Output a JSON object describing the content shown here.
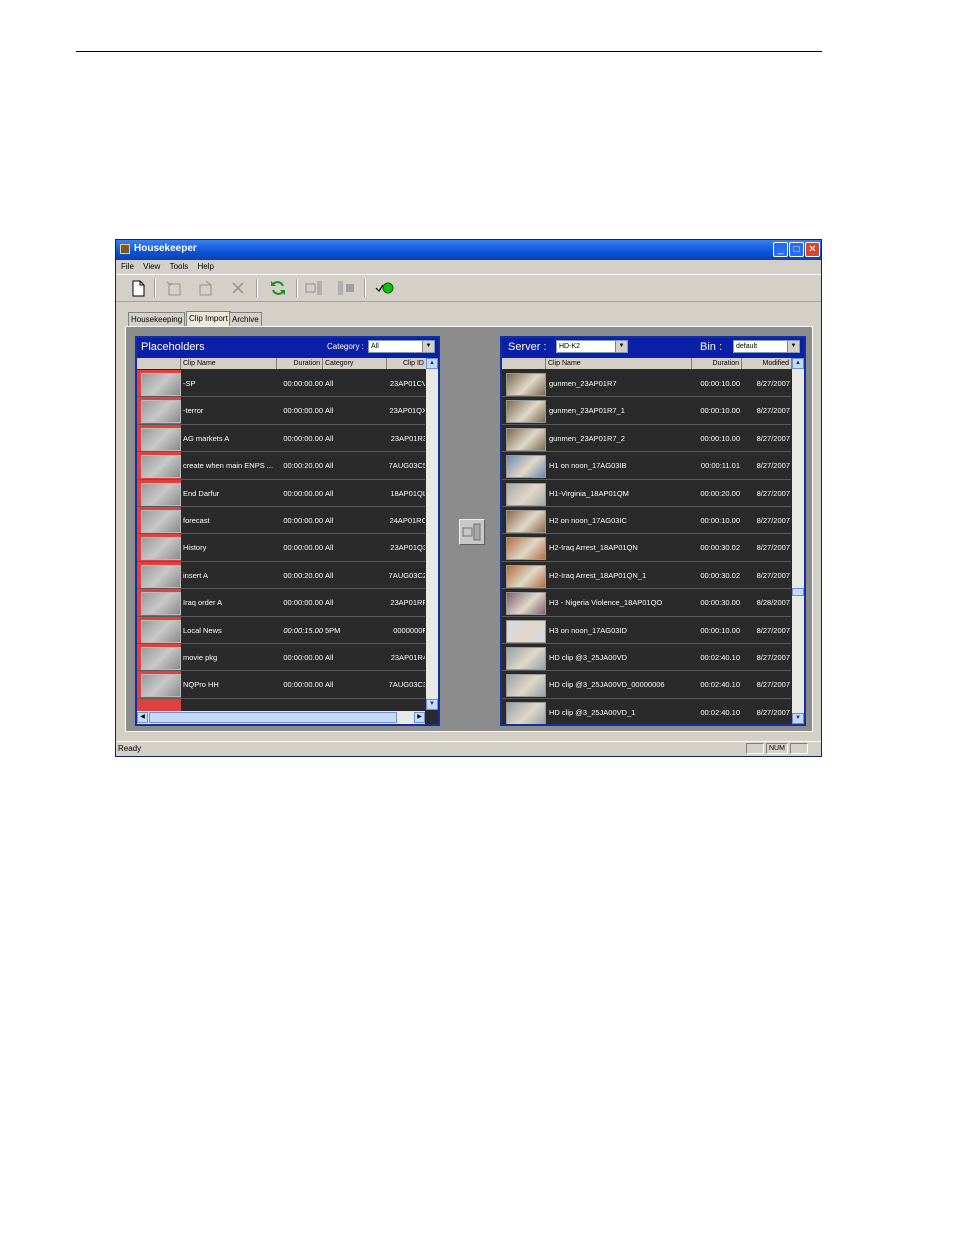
{
  "window": {
    "title": "Housekeeper"
  },
  "menu": [
    "File",
    "View",
    "Tools",
    "Help"
  ],
  "tabs": [
    {
      "label": "Housekeeping"
    },
    {
      "label": "Clip Import"
    },
    {
      "label": "Archive"
    }
  ],
  "placeholders": {
    "title": "Placeholders",
    "category_label": "Category :",
    "category_value": "All",
    "columns": [
      "Clip Name",
      "Duration",
      "Category",
      "Clip ID"
    ],
    "rows": [
      {
        "name": "-SP",
        "duration": "00:00:00.00",
        "category": "All",
        "clip_id": "23AP01CV"
      },
      {
        "name": "-terror",
        "duration": "00:00:00.00",
        "category": "All",
        "clip_id": "23AP01QX"
      },
      {
        "name": "AG markets A",
        "duration": "00:00:00.00",
        "category": "All",
        "clip_id": "23AP01R3"
      },
      {
        "name": "create when main ENPS ...",
        "duration": "00:00:20.00",
        "category": "All",
        "clip_id": "7AUG03C5"
      },
      {
        "name": "End Darfur",
        "duration": "00:00:00.00",
        "category": "All",
        "clip_id": "18AP01QL"
      },
      {
        "name": "forecast",
        "duration": "00:00:00.00",
        "category": "All",
        "clip_id": "24AP01RC"
      },
      {
        "name": "History",
        "duration": "00:00:00.00",
        "category": "All",
        "clip_id": "23AP01Q3"
      },
      {
        "name": "insert A",
        "duration": "00:00:20.00",
        "category": "All",
        "clip_id": "7AUG03C2"
      },
      {
        "name": "Iraq order A",
        "duration": "00:00:00.00",
        "category": "All",
        "clip_id": "23AP01RF"
      },
      {
        "name": "Local News",
        "duration": "00:00:15.00",
        "category": "5PM",
        "clip_id": "0000000F"
      },
      {
        "name": "movie pkg",
        "duration": "00:00:00.00",
        "category": "All",
        "clip_id": "23AP01R4"
      },
      {
        "name": "NQPro HH",
        "duration": "00:00:00.00",
        "category": "All",
        "clip_id": "7AUG03C3"
      }
    ]
  },
  "server": {
    "server_label": "Server :",
    "server_value": "HD-K2",
    "bin_label": "Bin :",
    "bin_value": "default",
    "columns": [
      "Clip Name",
      "Duration",
      "Modified"
    ],
    "rows": [
      {
        "name": "gunmen_23AP01R7",
        "duration": "00:00:10.00",
        "modified": "8/27/2007",
        "thumb": "#7a6a50"
      },
      {
        "name": "gunmen_23AP01R7_1",
        "duration": "00:00:10.00",
        "modified": "8/27/2007",
        "thumb": "#7a6a50"
      },
      {
        "name": "gunmen_23AP01R7_2",
        "duration": "00:00:10.00",
        "modified": "8/27/2007",
        "thumb": "#7a6a50"
      },
      {
        "name": "H1 on noon_17AG03IB",
        "duration": "00:00:11.01",
        "modified": "8/27/2007",
        "thumb": "#6c88b0"
      },
      {
        "name": "H1-Virginia_18AP01QM",
        "duration": "00:00:20.00",
        "modified": "8/27/2007",
        "thumb": "#a8a8a8"
      },
      {
        "name": "H2 on noon_17AG03IC",
        "duration": "00:00:10.00",
        "modified": "8/27/2007",
        "thumb": "#8a6a48"
      },
      {
        "name": "H2-Iraq Arrest_18AP01QN",
        "duration": "00:00:30.02",
        "modified": "8/27/2007",
        "thumb": "#b07040"
      },
      {
        "name": "H2-Iraq Arrest_18AP01QN_1",
        "duration": "00:00:30.02",
        "modified": "8/27/2007",
        "thumb": "#b07040"
      },
      {
        "name": "H3 - Nigeria Violence_18AP01QO",
        "duration": "00:00:30.00",
        "modified": "8/28/2007",
        "thumb": "#806070"
      },
      {
        "name": "H3 on noon_17AG03ID",
        "duration": "00:00:10.00",
        "modified": "8/27/2007",
        "thumb": "#d8d8e8"
      },
      {
        "name": "HD clip @3_25JA00VD",
        "duration": "00:02:40.10",
        "modified": "8/27/2007",
        "thumb": "#98a0a8"
      },
      {
        "name": "HD clip @3_25JA00VD_00000006",
        "duration": "00:02:40.10",
        "modified": "8/27/2007",
        "thumb": "#98a0a8"
      },
      {
        "name": "HD clip @3_25JA00VD_1",
        "duration": "00:02:40.10",
        "modified": "8/27/2007",
        "thumb": "#98a0a8"
      }
    ]
  },
  "status": {
    "text": "Ready",
    "num": "NUM"
  }
}
